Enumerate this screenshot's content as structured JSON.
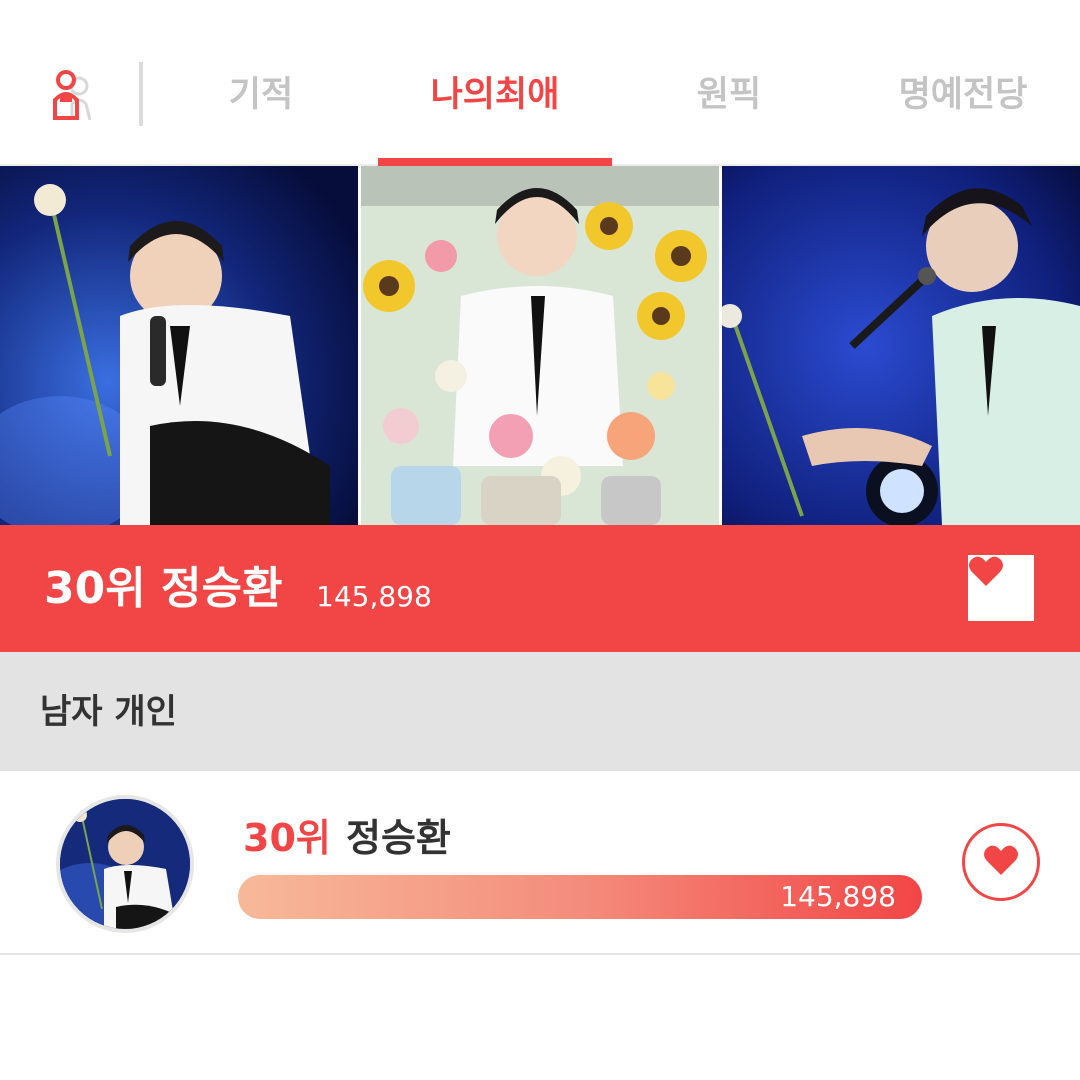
{
  "tabs": [
    {
      "label": "기적",
      "active": false
    },
    {
      "label": "나의최애",
      "active": true
    },
    {
      "label": "원픽",
      "active": false
    },
    {
      "label": "명예전당",
      "active": false
    }
  ],
  "icons": {
    "app_logo": "person-pin-icon",
    "vote": "heart-icon"
  },
  "colors": {
    "accent": "#f24646",
    "inactive_tab": "#c4c4c4",
    "category_bg": "#e3e3e3"
  },
  "hero": {
    "photos": [
      "concert-photo",
      "flower-photo",
      "concert-photo-2"
    ]
  },
  "banner": {
    "rank_name": "30위 정승환",
    "votes": "145,898"
  },
  "category": {
    "label": "남자 개인"
  },
  "entry": {
    "rank": "30위",
    "name": "정승환",
    "votes": "145,898"
  }
}
